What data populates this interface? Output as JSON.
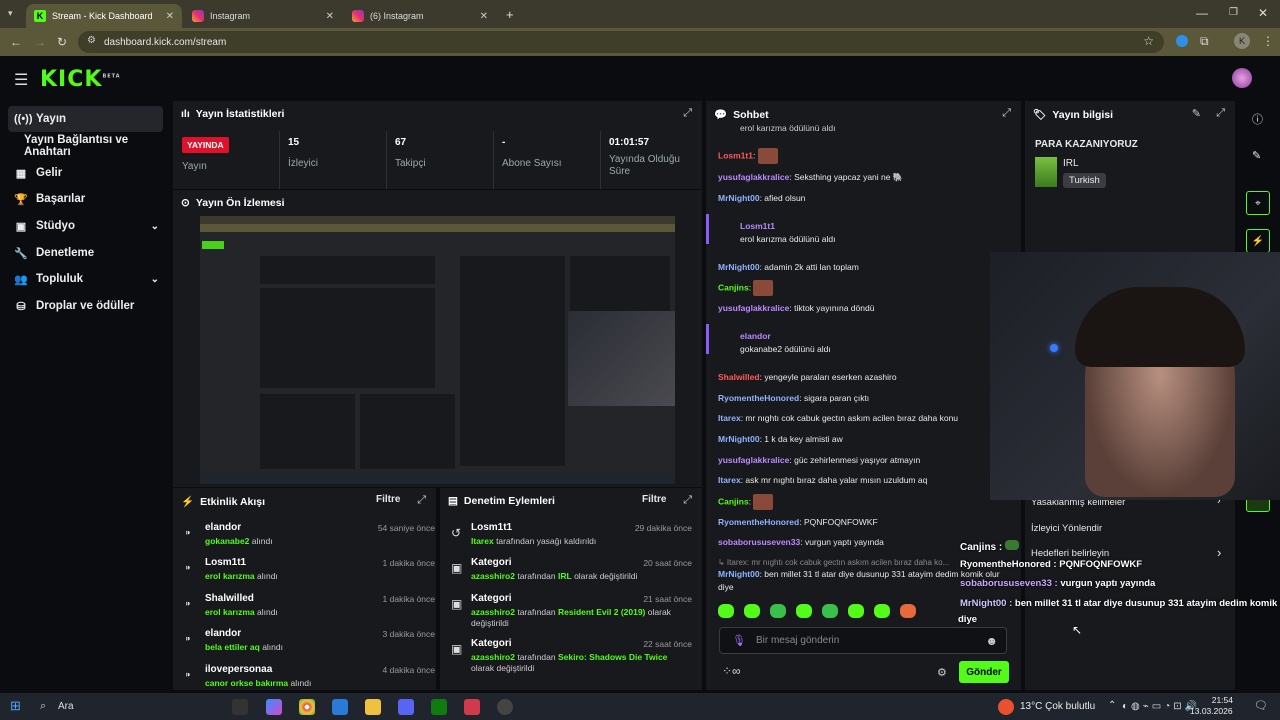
{
  "browser": {
    "tabs": [
      {
        "label": "Stream - Kick Dashboard"
      },
      {
        "label": "Instagram"
      },
      {
        "label": "(6) Instagram"
      }
    ],
    "url": "dashboard.kick.com/stream",
    "profile_initial": "K"
  },
  "logo": {
    "text": "KICK",
    "beta": "BETA"
  },
  "sidebar": {
    "items": [
      {
        "label": "Yayın",
        "icon": "broadcast-icon"
      },
      {
        "label": "Yayın Bağlantısı ve Anahtarı",
        "icon": ""
      },
      {
        "label": "Gelir",
        "icon": "bank-icon"
      },
      {
        "label": "Başarılar",
        "icon": "trophy-icon"
      },
      {
        "label": "Stüdyo",
        "icon": "grid-icon"
      },
      {
        "label": "Denetleme",
        "icon": "wrench-icon"
      },
      {
        "label": "Topluluk",
        "icon": "users-icon"
      },
      {
        "label": "Droplar ve ödüller",
        "icon": "drops-icon"
      }
    ]
  },
  "stats": {
    "title": "Yayın İstatistikleri",
    "status": "YAYINDA",
    "status_label": "Yayın",
    "viewers": "15",
    "viewers_label": "İzleyici",
    "followers": "67",
    "followers_label": "Takipçi",
    "subs": "-",
    "subs_label": "Abone Sayısı",
    "uptime": "01:01:57",
    "uptime_label": "Yayında Olduğu Süre"
  },
  "preview": {
    "title": "Yayın Ön İzlemesi"
  },
  "activity": {
    "title": "Etkinlik Akışı",
    "filter": "Filtre",
    "items": [
      {
        "name": "elandor",
        "sub_user": "gokanabe2",
        "sub_rest": "alındı",
        "time": "54 saniye önce"
      },
      {
        "name": "Losm1t1",
        "sub_user": "erol karızma",
        "sub_rest": "alındı",
        "time": "1 dakika önce"
      },
      {
        "name": "Shalwilled",
        "sub_user": "erol karızma",
        "sub_rest": "alındı",
        "time": "1 dakika önce"
      },
      {
        "name": "elandor",
        "sub_user": "bela ettiler aq",
        "sub_rest": "alındı",
        "time": "3 dakika önce"
      },
      {
        "name": "ilovepersonaa",
        "sub_user": "canor orkse bakırma",
        "sub_rest": "alındı",
        "time": "4 dakika önce"
      }
    ]
  },
  "moderation": {
    "title": "Denetim Eylemleri",
    "filter": "Filtre",
    "items": [
      {
        "name": "Losm1t1",
        "sub_user": "Itarex",
        "sub_rest": "tarafından yasağı kaldırıldı",
        "time": "29 dakika önce"
      },
      {
        "name": "Kategori",
        "sub_user": "azasshiro2",
        "sub_mid": "tarafından",
        "sub_val": "IRL",
        "sub_rest": "olarak değiştirildi",
        "time": "20 saat önce"
      },
      {
        "name": "Kategori",
        "sub_user": "azasshiro2",
        "sub_mid": "tarafından",
        "sub_val": "Resident Evil 2 (2019)",
        "sub_rest": "olarak değiştirildi",
        "time": "21 saat önce"
      },
      {
        "name": "Kategori",
        "sub_user": "azasshiro2",
        "sub_mid": "tarafından",
        "sub_val": "Sekiro: Shadows Die Twice",
        "sub_rest": "olarak değiştirildi",
        "time": "22 saat önce"
      }
    ]
  },
  "chat": {
    "title": "Sohbet",
    "top_line": "erol karızma ödülünü aldı",
    "placeholder": "Bir mesaj gönderin",
    "send": "Gönder",
    "messages": [
      {
        "user": "Losm1t1",
        "color": "#ff5a5a",
        "text": "",
        "emote": true
      },
      {
        "user": "yusufaglakkralice",
        "color": "#b98aff",
        "text": "Seksthing yapcaz yani ne 🐘"
      },
      {
        "user": "MrNight00",
        "color": "#8fb3ff",
        "text": "afied olsun"
      },
      {
        "user": "Losm1t1",
        "color": "#b98aff",
        "sys": "erol karızma ödülünü aldı"
      },
      {
        "user": "MrNight00",
        "color": "#8fb3ff",
        "text": "adamin 2k atti lan toplam"
      },
      {
        "user": "Canjins",
        "color": "#53fc18",
        "text": "",
        "emote": true
      },
      {
        "user": "yusufaglakkralice",
        "color": "#b98aff",
        "text": "tiktok yayınına döndü"
      },
      {
        "user": "elandor",
        "color": "#b98aff",
        "sys": "gokanabe2 ödülünü aldı"
      },
      {
        "user": "Shalwilled",
        "color": "#ff5a5a",
        "text": "yengeyle paraları eserken azashiro"
      },
      {
        "user": "RyomentheHonored",
        "color": "#8fb3ff",
        "text": "sigara paran çıktı"
      },
      {
        "user": "Itarex",
        "color": "#8fb3ff",
        "text": "mr nıghtı cok cabuk gectın askım acilen bıraz daha konu"
      },
      {
        "user": "MrNight00",
        "color": "#8fb3ff",
        "text": "1 k da key almisti aw"
      },
      {
        "user": "yusufaglakkralice",
        "color": "#b98aff",
        "text": "güc zehirlenmesi yaşıyor atmayın"
      },
      {
        "user": "Itarex",
        "color": "#8fb3ff",
        "text": "ask mr nıghtı bıraz daha yalar mısın uzuldum aq"
      },
      {
        "user": "Canjins",
        "color": "#53fc18",
        "text": "",
        "emote": true
      },
      {
        "user": "RyomentheHonored",
        "color": "#8fb3ff",
        "text": "PQNFOQNFOWKF"
      },
      {
        "user": "sobaborususeven33",
        "color": "#b98aff",
        "text": "vurgun yaptı yayında"
      },
      {
        "user": "",
        "color": "#888",
        "text": "↳ Itarex: mr nıghtı cok cabuk gectın askım acilen bıraz daha ko..."
      },
      {
        "user": "MrNight00",
        "color": "#8fb3ff",
        "text": "ben millet 31 tl atar diye dusunup 331 atayim dedim komik olur diye"
      }
    ]
  },
  "info": {
    "title": "Yayın bilgisi",
    "stream_title": "PARA KAZANIYORUZ",
    "category": "IRL",
    "tag": "Turkish",
    "menu": [
      {
        "label": "Yasaklanmış kelimeler"
      },
      {
        "label": "İzleyici Yönlendir"
      },
      {
        "label": "Hedefleri belirleyin"
      }
    ]
  },
  "overlay": [
    {
      "user": "Canjins :",
      "text": ""
    },
    {
      "user": "RyomentheHonored :",
      "text": "PQNFOQNFOWKF"
    },
    {
      "user": "sobaborususeven33 :",
      "text": "vurgun yaptı yayında"
    },
    {
      "user": "MrNight00 :",
      "text": "ben millet 31 tl atar diye dusunup 331 atayim dedim komik"
    },
    {
      "user": "",
      "text": "diye"
    }
  ],
  "taskbar": {
    "search": "Ara",
    "weather": "13°C  Çok bulutlu",
    "time": "21:54",
    "date": "13.03.2026"
  },
  "colors": {
    "accent": "#53fc18",
    "live": "#e0112b",
    "panel": "#18191d"
  }
}
